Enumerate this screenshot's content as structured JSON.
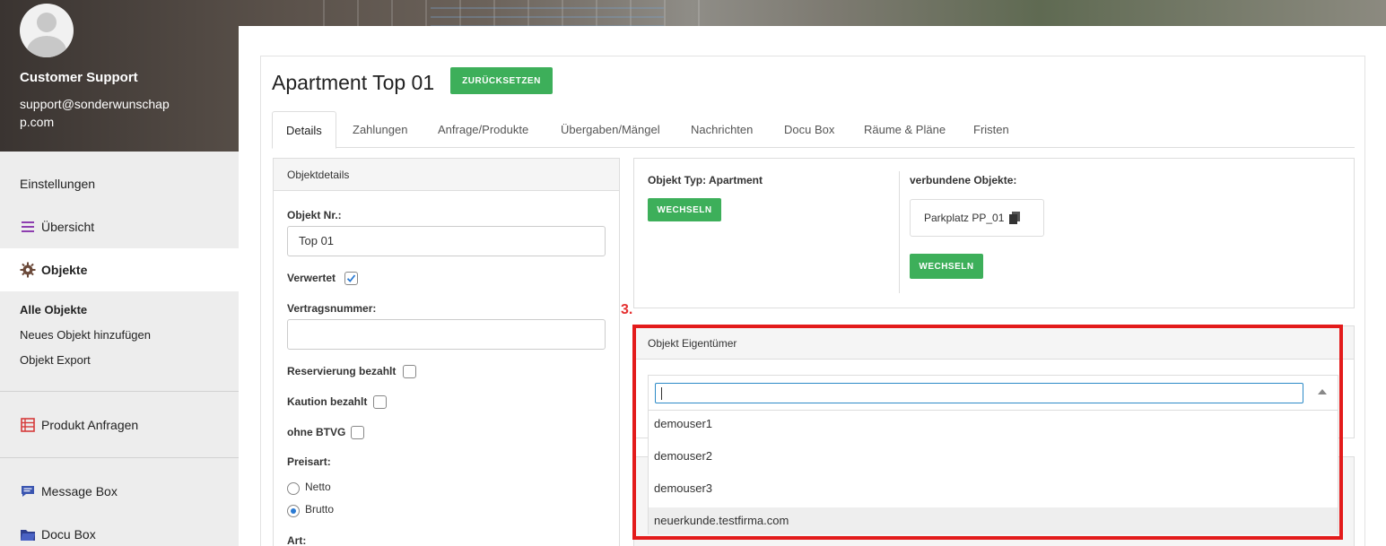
{
  "profile": {
    "name": "Customer Support",
    "email": "support@sonderwunschapp.com"
  },
  "sidebar": {
    "items": [
      {
        "label": "Einstellungen"
      },
      {
        "label": "Übersicht",
        "icon": "list-icon"
      },
      {
        "label": "Objekte",
        "icon": "gear-icon"
      },
      {
        "label": "Produkt Anfragen",
        "icon": "table-icon"
      },
      {
        "label": "Message Box",
        "icon": "message-icon"
      },
      {
        "label": "Docu Box",
        "icon": "folder-icon"
      }
    ],
    "sub_items": [
      {
        "label": "Alle Objekte"
      },
      {
        "label": "Neues Objekt hinzufügen"
      },
      {
        "label": "Objekt Export"
      }
    ]
  },
  "page": {
    "title": "Apartment Top 01",
    "reset_label": "ZURÜCKSETZEN",
    "tabs": [
      "Details",
      "Zahlungen",
      "Anfrage/Produkte",
      "Übergaben/Mängel",
      "Nachrichten",
      "Docu Box",
      "Räume & Pläne",
      "Fristen"
    ]
  },
  "details": {
    "header": "Objektdetails",
    "objekt_nr_label": "Objekt Nr.:",
    "objekt_nr_value": "Top 01",
    "verwertet_label": "Verwertet",
    "vertragsnummer_label": "Vertragsnummer:",
    "vertragsnummer_value": "",
    "reservierung_label": "Reservierung bezahlt",
    "kaution_label": "Kaution bezahlt",
    "btvg_label": "ohne BTVG",
    "preisart_label": "Preisart:",
    "preisart_options": [
      "Netto",
      "Brutto"
    ],
    "preisart_selected": "Brutto",
    "art_label": "Art:"
  },
  "object_type": {
    "label": "Objekt Typ: Apartment",
    "change_label": "WECHSELN",
    "linked_label": "verbundene Objekte:",
    "linked_item": "Parkplatz PP_01",
    "linked_change_label": "WECHSELN"
  },
  "annotation": {
    "step": "3."
  },
  "owner": {
    "header": "Objekt Eigentümer",
    "search_value": "",
    "options": [
      "demouser1",
      "demouser2",
      "demouser3",
      "neuerkunde.testfirma.com"
    ],
    "highlighted": "neuerkunde.testfirma.com"
  },
  "colors": {
    "accent_green": "#3daf5a",
    "annotation_red": "#e31b1b",
    "focus_blue": "#2d8ac7"
  }
}
